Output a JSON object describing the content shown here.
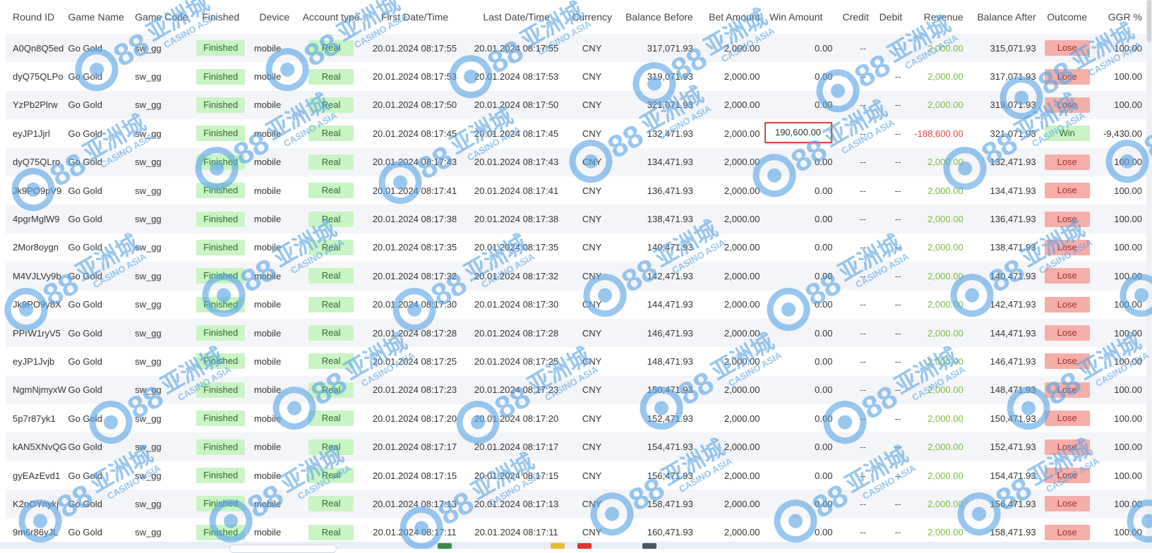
{
  "columns": [
    {
      "key": "round_id",
      "label": "Round ID"
    },
    {
      "key": "game_name",
      "label": "Game Name"
    },
    {
      "key": "game_code",
      "label": "Game Code"
    },
    {
      "key": "finished",
      "label": "Finished"
    },
    {
      "key": "device",
      "label": "Device"
    },
    {
      "key": "account_type",
      "label": "Account type"
    },
    {
      "key": "first_dt",
      "label": "First Date/Time"
    },
    {
      "key": "last_dt",
      "label": "Last Date/Time"
    },
    {
      "key": "currency",
      "label": "Currency"
    },
    {
      "key": "balance_before",
      "label": "Balance Before"
    },
    {
      "key": "bet_amount",
      "label": "Bet Amount"
    },
    {
      "key": "win_amount",
      "label": "Win Amount"
    },
    {
      "key": "credit",
      "label": "Credit"
    },
    {
      "key": "debit",
      "label": "Debit"
    },
    {
      "key": "revenue",
      "label": "Revenue"
    },
    {
      "key": "balance_after",
      "label": "Balance After"
    },
    {
      "key": "outcome",
      "label": "Outcome"
    },
    {
      "key": "ggr",
      "label": "GGR %"
    }
  ],
  "rows": [
    {
      "round_id": "A0Qn8Q5ed",
      "game_name": "Go Gold",
      "game_code": "sw_gg",
      "finished": "Finished",
      "device": "mobile",
      "account_type": "Real",
      "first_dt": "20.01.2024 08:17:55",
      "last_dt": "20.01.2024 08:17:55",
      "currency": "CNY",
      "balance_before": "317,071.93",
      "bet_amount": "2,000.00",
      "win_amount": "0.00",
      "credit": "--",
      "debit": "--",
      "revenue": "2,000.00",
      "balance_after": "315,071.93",
      "outcome": "Lose",
      "ggr": "100.00"
    },
    {
      "round_id": "dyQ75QLPo",
      "game_name": "Go Gold",
      "game_code": "sw_gg",
      "finished": "Finished",
      "device": "mobile",
      "account_type": "Real",
      "first_dt": "20.01.2024 08:17:53",
      "last_dt": "20.01.2024 08:17:53",
      "currency": "CNY",
      "balance_before": "319,071.93",
      "bet_amount": "2,000.00",
      "win_amount": "0.00",
      "credit": "--",
      "debit": "--",
      "revenue": "2,000.00",
      "balance_after": "317,071.93",
      "outcome": "Lose",
      "ggr": "100.00"
    },
    {
      "round_id": "YzPb2Plrw",
      "game_name": "Go Gold",
      "game_code": "sw_gg",
      "finished": "Finished",
      "device": "mobile",
      "account_type": "Real",
      "first_dt": "20.01.2024 08:17:50",
      "last_dt": "20.01.2024 08:17:50",
      "currency": "CNY",
      "balance_before": "321,071.93",
      "bet_amount": "2,000.00",
      "win_amount": "0.00",
      "credit": "--",
      "debit": "--",
      "revenue": "2,000.00",
      "balance_after": "319,071.93",
      "outcome": "Lose",
      "ggr": "100.00"
    },
    {
      "round_id": "eyJP1Jjrl",
      "game_name": "Go Gold",
      "game_code": "sw_gg",
      "finished": "Finished",
      "device": "mobile",
      "account_type": "Real",
      "first_dt": "20.01.2024 08:17:45",
      "last_dt": "20.01.2024 08:17:45",
      "currency": "CNY",
      "balance_before": "132,471.93",
      "bet_amount": "2,000.00",
      "win_amount": "190,600.00",
      "credit": "--",
      "debit": "--",
      "revenue": "-188,600.00",
      "balance_after": "321,071.93",
      "outcome": "Win",
      "ggr": "-9,430.00",
      "highlight": true
    },
    {
      "round_id": "dyQ75QLro",
      "game_name": "Go Gold",
      "game_code": "sw_gg",
      "finished": "Finished",
      "device": "mobile",
      "account_type": "Real",
      "first_dt": "20.01.2024 08:17:43",
      "last_dt": "20.01.2024 08:17:43",
      "currency": "CNY",
      "balance_before": "134,471.93",
      "bet_amount": "2,000.00",
      "win_amount": "0.00",
      "credit": "--",
      "debit": "--",
      "revenue": "2,000.00",
      "balance_after": "132,471.93",
      "outcome": "Lose",
      "ggr": "100.00"
    },
    {
      "round_id": "Jk9PO9pV9",
      "game_name": "Go Gold",
      "game_code": "sw_gg",
      "finished": "Finished",
      "device": "mobile",
      "account_type": "Real",
      "first_dt": "20.01.2024 08:17:41",
      "last_dt": "20.01.2024 08:17:41",
      "currency": "CNY",
      "balance_before": "136,471.93",
      "bet_amount": "2,000.00",
      "win_amount": "0.00",
      "credit": "--",
      "debit": "--",
      "revenue": "2,000.00",
      "balance_after": "134,471.93",
      "outcome": "Lose",
      "ggr": "100.00"
    },
    {
      "round_id": "4pgrMglW9",
      "game_name": "Go Gold",
      "game_code": "sw_gg",
      "finished": "Finished",
      "device": "mobile",
      "account_type": "Real",
      "first_dt": "20.01.2024 08:17:38",
      "last_dt": "20.01.2024 08:17:38",
      "currency": "CNY",
      "balance_before": "138,471.93",
      "bet_amount": "2,000.00",
      "win_amount": "0.00",
      "credit": "--",
      "debit": "--",
      "revenue": "2,000.00",
      "balance_after": "136,471.93",
      "outcome": "Lose",
      "ggr": "100.00"
    },
    {
      "round_id": "2Mor8oygn",
      "game_name": "Go Gold",
      "game_code": "sw_gg",
      "finished": "Finished",
      "device": "mobile",
      "account_type": "Real",
      "first_dt": "20.01.2024 08:17:35",
      "last_dt": "20.01.2024 08:17:35",
      "currency": "CNY",
      "balance_before": "140,471.93",
      "bet_amount": "2,000.00",
      "win_amount": "0.00",
      "credit": "--",
      "debit": "--",
      "revenue": "2,000.00",
      "balance_after": "138,471.93",
      "outcome": "Lose",
      "ggr": "100.00"
    },
    {
      "round_id": "M4VJLVy9b",
      "game_name": "Go Gold",
      "game_code": "sw_gg",
      "finished": "Finished",
      "device": "mobile",
      "account_type": "Real",
      "first_dt": "20.01.2024 08:17:32",
      "last_dt": "20.01.2024 08:17:32",
      "currency": "CNY",
      "balance_before": "142,471.93",
      "bet_amount": "2,000.00",
      "win_amount": "0.00",
      "credit": "--",
      "debit": "--",
      "revenue": "2,000.00",
      "balance_after": "140,471.93",
      "outcome": "Lose",
      "ggr": "100.00"
    },
    {
      "round_id": "Jk9PO9y8X",
      "game_name": "Go Gold",
      "game_code": "sw_gg",
      "finished": "Finished",
      "device": "mobile",
      "account_type": "Real",
      "first_dt": "20.01.2024 08:17:30",
      "last_dt": "20.01.2024 08:17:30",
      "currency": "CNY",
      "balance_before": "144,471.93",
      "bet_amount": "2,000.00",
      "win_amount": "0.00",
      "credit": "--",
      "debit": "--",
      "revenue": "2,000.00",
      "balance_after": "142,471.93",
      "outcome": "Lose",
      "ggr": "100.00"
    },
    {
      "round_id": "PPrW1ryV5",
      "game_name": "Go Gold",
      "game_code": "sw_gg",
      "finished": "Finished",
      "device": "mobile",
      "account_type": "Real",
      "first_dt": "20.01.2024 08:17:28",
      "last_dt": "20.01.2024 08:17:28",
      "currency": "CNY",
      "balance_before": "146,471.93",
      "bet_amount": "2,000.00",
      "win_amount": "0.00",
      "credit": "--",
      "debit": "--",
      "revenue": "2,000.00",
      "balance_after": "144,471.93",
      "outcome": "Lose",
      "ggr": "100.00"
    },
    {
      "round_id": "eyJP1Jvjb",
      "game_name": "Go Gold",
      "game_code": "sw_gg",
      "finished": "Finished",
      "device": "mobile",
      "account_type": "Real",
      "first_dt": "20.01.2024 08:17:25",
      "last_dt": "20.01.2024 08:17:25",
      "currency": "CNY",
      "balance_before": "148,471.93",
      "bet_amount": "2,000.00",
      "win_amount": "0.00",
      "credit": "--",
      "debit": "--",
      "revenue": "2,000.00",
      "balance_after": "146,471.93",
      "outcome": "Lose",
      "ggr": "100.00"
    },
    {
      "round_id": "NgmNjmyxW",
      "game_name": "Go Gold",
      "game_code": "sw_gg",
      "finished": "Finished",
      "device": "mobile",
      "account_type": "Real",
      "first_dt": "20.01.2024 08:17:23",
      "last_dt": "20.01.2024 08:17:23",
      "currency": "CNY",
      "balance_before": "150,471.93",
      "bet_amount": "2,000.00",
      "win_amount": "0.00",
      "credit": "--",
      "debit": "--",
      "revenue": "2,000.00",
      "balance_after": "148,471.93",
      "outcome": "Lose",
      "ggr": "100.00"
    },
    {
      "round_id": "5p7r87yk1",
      "game_name": "Go Gold",
      "game_code": "sw_gg",
      "finished": "Finished",
      "device": "mobile",
      "account_type": "Real",
      "first_dt": "20.01.2024 08:17:20",
      "last_dt": "20.01.2024 08:17:20",
      "currency": "CNY",
      "balance_before": "152,471.93",
      "bet_amount": "2,000.00",
      "win_amount": "0.00",
      "credit": "--",
      "debit": "--",
      "revenue": "2,000.00",
      "balance_after": "150,471.93",
      "outcome": "Lose",
      "ggr": "100.00"
    },
    {
      "round_id": "kAN5XNvQG",
      "game_name": "Go Gold",
      "game_code": "sw_gg",
      "finished": "Finished",
      "device": "mobile",
      "account_type": "Real",
      "first_dt": "20.01.2024 08:17:17",
      "last_dt": "20.01.2024 08:17:17",
      "currency": "CNY",
      "balance_before": "154,471.93",
      "bet_amount": "2,000.00",
      "win_amount": "0.00",
      "credit": "--",
      "debit": "--",
      "revenue": "2,000.00",
      "balance_after": "152,471.93",
      "outcome": "Lose",
      "ggr": "100.00"
    },
    {
      "round_id": "gyEAzEvd1",
      "game_name": "Go Gold",
      "game_code": "sw_gg",
      "finished": "Finished",
      "device": "mobile",
      "account_type": "Real",
      "first_dt": "20.01.2024 08:17:15",
      "last_dt": "20.01.2024 08:17:15",
      "currency": "CNY",
      "balance_before": "156,471.93",
      "bet_amount": "2,000.00",
      "win_amount": "0.00",
      "credit": "--",
      "debit": "--",
      "revenue": "2,000.00",
      "balance_after": "154,471.93",
      "outcome": "Lose",
      "ggr": "100.00"
    },
    {
      "round_id": "K2nOYnykj",
      "game_name": "Go Gold",
      "game_code": "sw_gg",
      "finished": "Finished",
      "device": "mobile",
      "account_type": "Real",
      "first_dt": "20.01.2024 08:17:13",
      "last_dt": "20.01.2024 08:17:13",
      "currency": "CNY",
      "balance_before": "158,471.93",
      "bet_amount": "2,000.00",
      "win_amount": "0.00",
      "credit": "--",
      "debit": "--",
      "revenue": "2,000.00",
      "balance_after": "156,471.93",
      "outcome": "Lose",
      "ggr": "100.00"
    },
    {
      "round_id": "9m6r86yJL",
      "game_name": "Go Gold",
      "game_code": "sw_gg",
      "finished": "Finished",
      "device": "mobile",
      "account_type": "Real",
      "first_dt": "20.01.2024 08:17:11",
      "last_dt": "20.01.2024 08:17:11",
      "currency": "CNY",
      "balance_before": "160,471.93",
      "bet_amount": "2,000.00",
      "win_amount": "0.00",
      "credit": "--",
      "debit": "--",
      "revenue": "2,000.00",
      "balance_after": "158,471.93",
      "outcome": "Lose",
      "ggr": "100.00"
    }
  ],
  "colors": {
    "badge_green_bg": "#c8f5c3",
    "badge_red_bg": "#f6aea9",
    "revenue_positive": "#7bbd3b",
    "revenue_negative": "#e0484a",
    "highlight_border": "#d44a3b",
    "watermark": "#5aa5e6"
  },
  "watermark": {
    "logo_number": "88",
    "chinese_text": "亚洲城",
    "english_text": "CASINO ASIA"
  }
}
